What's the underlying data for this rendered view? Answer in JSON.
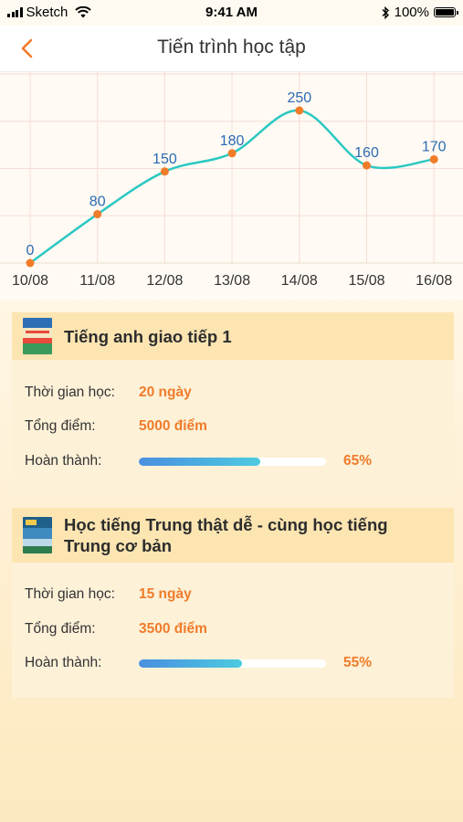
{
  "status_bar": {
    "carrier": "Sketch",
    "time": "9:41 AM",
    "battery": "100%"
  },
  "header": {
    "title": "Tiến trình học tập",
    "back_icon": "chevron-left-icon"
  },
  "chart_data": {
    "type": "line",
    "categories": [
      "10/08",
      "11/08",
      "12/08",
      "13/08",
      "14/08",
      "15/08",
      "16/08"
    ],
    "values": [
      0,
      80,
      150,
      180,
      250,
      160,
      170
    ],
    "data_labels": [
      "0",
      "80",
      "150",
      "180",
      "250",
      "160",
      "170"
    ],
    "ylim": [
      0,
      250
    ],
    "grid": true,
    "colors": {
      "line": "#2bc8c2",
      "point": "#f07c2a",
      "label": "#2a6bb3",
      "grid": "#f6ded6"
    }
  },
  "courses": [
    {
      "title": "Tiếng anh giao tiếp 1",
      "rows": {
        "time_label": "Thời gian học:",
        "time_value": "20 ngày",
        "score_label": "Tổng điểm:",
        "score_value": "5000 điểm",
        "done_label": "Hoàn thành:",
        "done_value": "65%"
      },
      "progress": 0.65
    },
    {
      "title": "Học tiếng Trung thật dễ - cùng học tiếng Trung cơ bản",
      "rows": {
        "time_label": "Thời gian học:",
        "time_value": "15 ngày",
        "score_label": "Tổng điểm:",
        "score_value": "3500 điểm",
        "done_label": "Hoàn thành:",
        "done_value": "55%"
      },
      "progress": 0.55
    }
  ],
  "accent_color": "#f07c2a"
}
